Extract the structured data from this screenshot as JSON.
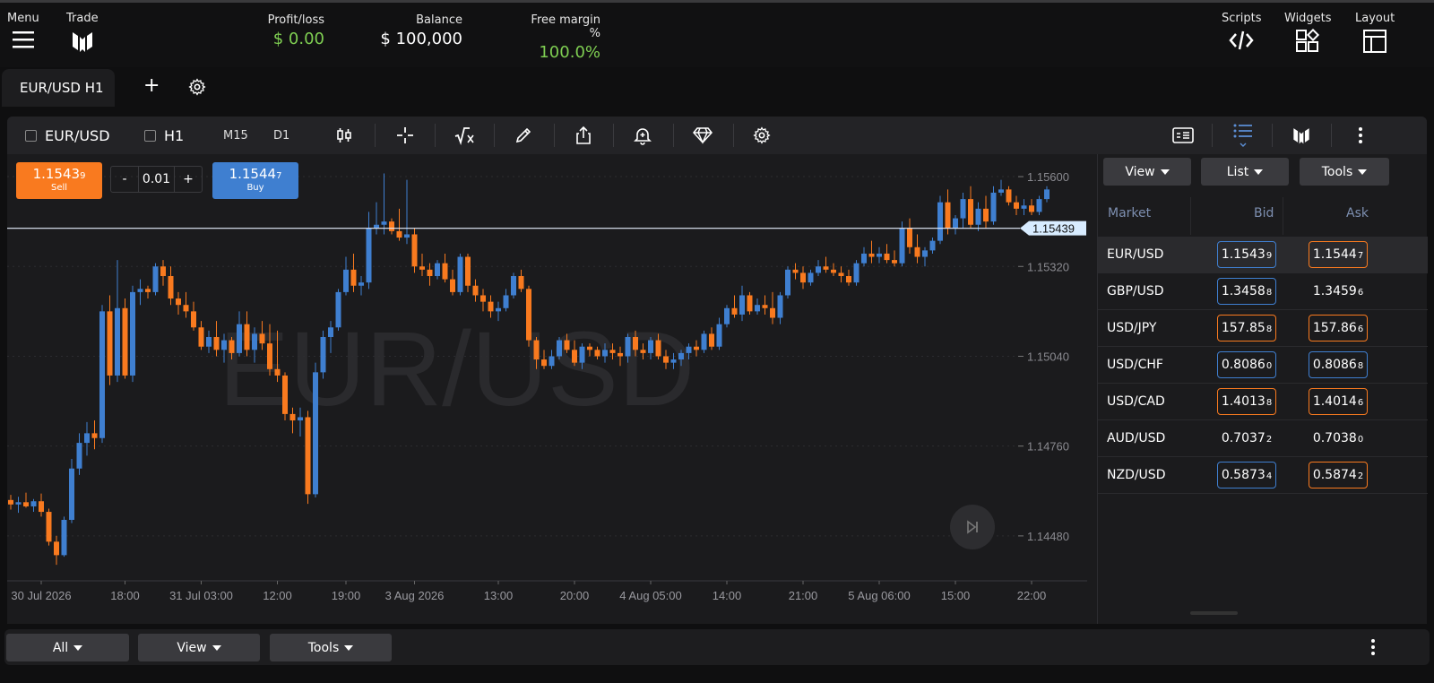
{
  "topbar": {
    "menu_label": "Menu",
    "trade_label": "Trade",
    "profit_loss_label": "Profit/loss",
    "profit_loss_value": "$ 0.00",
    "balance_label": "Balance",
    "balance_value": "$ 100,000",
    "free_margin_label": "Free margin %",
    "free_margin_value": "100.0%",
    "scripts_label": "Scripts",
    "widgets_label": "Widgets",
    "layout_label": "Layout"
  },
  "tabs": {
    "active_label": "EUR/USD H1",
    "add_label": "+"
  },
  "toolbar": {
    "symbol": "EUR/USD",
    "timeframe": "H1",
    "tf_m15": "M15",
    "tf_d1": "D1"
  },
  "order": {
    "sell_price_main": "1.1543",
    "sell_price_pip": "9",
    "sell_label": "Sell",
    "qty_minus": "-",
    "qty_value": "0.01",
    "qty_plus": "+",
    "buy_price_main": "1.1544",
    "buy_price_pip": "7",
    "buy_label": "Buy"
  },
  "colors": {
    "up": "#3f7fd0",
    "down": "#f97a1f",
    "green_value": "#7fcf52"
  },
  "chart_data": {
    "type": "candlestick",
    "watermark": "EUR/USD",
    "current_price_label": "1.15439",
    "current_price": 1.15439,
    "ylim": [
      1.1434,
      1.1567
    ],
    "y_ticks": [
      "1.15600",
      "1.15320",
      "1.15040",
      "1.14760",
      "1.14480"
    ],
    "y_tick_values": [
      1.156,
      1.1532,
      1.1504,
      1.1476,
      1.1448
    ],
    "x_ticks": [
      "30 Jul 2026",
      "18:00",
      "31 Jul 03:00",
      "12:00",
      "19:00",
      "3 Aug 2026",
      "13:00",
      "20:00",
      "4 Aug 05:00",
      "14:00",
      "21:00",
      "5 Aug 06:00",
      "15:00",
      "22:00"
    ],
    "x_tick_index": [
      4,
      15,
      25,
      35,
      44,
      53,
      64,
      74,
      84,
      94,
      104,
      114,
      124,
      134
    ],
    "candles": [
      [
        1.14592,
        1.14608,
        1.14562,
        1.14578
      ],
      [
        1.14578,
        1.14602,
        1.14552,
        1.14585
      ],
      [
        1.14585,
        1.14615,
        1.14568,
        1.14572
      ],
      [
        1.14572,
        1.14595,
        1.14555,
        1.14588
      ],
      [
        1.14588,
        1.14612,
        1.1454,
        1.14555
      ],
      [
        1.14555,
        1.14565,
        1.1445,
        1.14462
      ],
      [
        1.14462,
        1.1448,
        1.1439,
        1.1442
      ],
      [
        1.1442,
        1.1454,
        1.14415,
        1.1453
      ],
      [
        1.1453,
        1.1472,
        1.1452,
        1.1469
      ],
      [
        1.1469,
        1.148,
        1.1467,
        1.1477
      ],
      [
        1.1477,
        1.14835,
        1.1473,
        1.148
      ],
      [
        1.148,
        1.1484,
        1.1475,
        1.14785
      ],
      [
        1.14785,
        1.152,
        1.1477,
        1.1518
      ],
      [
        1.1518,
        1.1523,
        1.1495,
        1.1498
      ],
      [
        1.1498,
        1.1534,
        1.1496,
        1.1519
      ],
      [
        1.1519,
        1.1522,
        1.1497,
        1.1498
      ],
      [
        1.1498,
        1.1526,
        1.1496,
        1.1524
      ],
      [
        1.1524,
        1.1528,
        1.152,
        1.1525
      ],
      [
        1.1525,
        1.1526,
        1.1522,
        1.1524
      ],
      [
        1.1524,
        1.1533,
        1.1523,
        1.1532
      ],
      [
        1.1532,
        1.1534,
        1.1526,
        1.1529
      ],
      [
        1.1529,
        1.1532,
        1.152,
        1.1522
      ],
      [
        1.1522,
        1.1524,
        1.1517,
        1.152
      ],
      [
        1.152,
        1.1524,
        1.1516,
        1.1518
      ],
      [
        1.1518,
        1.1521,
        1.1512,
        1.1513
      ],
      [
        1.1513,
        1.1515,
        1.1506,
        1.1507
      ],
      [
        1.1507,
        1.1512,
        1.1505,
        1.151
      ],
      [
        1.151,
        1.1515,
        1.1504,
        1.1506
      ],
      [
        1.1506,
        1.1511,
        1.1502,
        1.1509
      ],
      [
        1.1509,
        1.151,
        1.1503,
        1.1505
      ],
      [
        1.1505,
        1.1518,
        1.1504,
        1.1514
      ],
      [
        1.1514,
        1.1518,
        1.1504,
        1.1506
      ],
      [
        1.1506,
        1.1513,
        1.1502,
        1.1511
      ],
      [
        1.1511,
        1.1515,
        1.1506,
        1.1508
      ],
      [
        1.1508,
        1.1514,
        1.1498,
        1.15
      ],
      [
        1.15,
        1.1512,
        1.1496,
        1.1498
      ],
      [
        1.1498,
        1.1499,
        1.1484,
        1.1486
      ],
      [
        1.1486,
        1.1488,
        1.148,
        1.1484
      ],
      [
        1.1484,
        1.1488,
        1.1479,
        1.1485
      ],
      [
        1.1485,
        1.1487,
        1.1458,
        1.1461
      ],
      [
        1.1461,
        1.1502,
        1.146,
        1.1499
      ],
      [
        1.1499,
        1.1512,
        1.1497,
        1.151
      ],
      [
        1.151,
        1.1515,
        1.1505,
        1.1513
      ],
      [
        1.1513,
        1.1525,
        1.1512,
        1.1524
      ],
      [
        1.1524,
        1.1535,
        1.1523,
        1.1531
      ],
      [
        1.1531,
        1.1536,
        1.1524,
        1.1526
      ],
      [
        1.1526,
        1.1529,
        1.1523,
        1.1527
      ],
      [
        1.1527,
        1.1549,
        1.1525,
        1.1544
      ],
      [
        1.1544,
        1.1552,
        1.1542,
        1.1545
      ],
      [
        1.1545,
        1.1561,
        1.1542,
        1.1546
      ],
      [
        1.1546,
        1.1547,
        1.1542,
        1.1543
      ],
      [
        1.1543,
        1.155,
        1.154,
        1.1541
      ],
      [
        1.1541,
        1.1559,
        1.1539,
        1.1542
      ],
      [
        1.1542,
        1.1544,
        1.153,
        1.1532
      ],
      [
        1.1532,
        1.1536,
        1.1529,
        1.1531
      ],
      [
        1.1531,
        1.1533,
        1.1526,
        1.1529
      ],
      [
        1.1529,
        1.1534,
        1.1528,
        1.1533
      ],
      [
        1.1533,
        1.1536,
        1.1527,
        1.1528
      ],
      [
        1.1528,
        1.1531,
        1.1523,
        1.1524
      ],
      [
        1.1524,
        1.1536,
        1.1523,
        1.1535
      ],
      [
        1.1535,
        1.1536,
        1.1524,
        1.1526
      ],
      [
        1.1526,
        1.1528,
        1.1521,
        1.1523
      ],
      [
        1.1523,
        1.1525,
        1.1518,
        1.1521
      ],
      [
        1.1521,
        1.1523,
        1.1516,
        1.1518
      ],
      [
        1.1518,
        1.1521,
        1.1515,
        1.1519
      ],
      [
        1.1519,
        1.1525,
        1.1518,
        1.1523
      ],
      [
        1.1523,
        1.153,
        1.1522,
        1.1529
      ],
      [
        1.1529,
        1.1531,
        1.1524,
        1.1525
      ],
      [
        1.1525,
        1.1526,
        1.1507,
        1.1509
      ],
      [
        1.1509,
        1.151,
        1.15,
        1.1503
      ],
      [
        1.1503,
        1.1506,
        1.15,
        1.1501
      ],
      [
        1.1501,
        1.1506,
        1.15,
        1.1504
      ],
      [
        1.1504,
        1.151,
        1.1503,
        1.1509
      ],
      [
        1.1509,
        1.1511,
        1.1505,
        1.1506
      ],
      [
        1.1506,
        1.1509,
        1.1501,
        1.1502
      ],
      [
        1.1502,
        1.1508,
        1.15,
        1.1507
      ],
      [
        1.1507,
        1.1508,
        1.1504,
        1.1506
      ],
      [
        1.1506,
        1.1507,
        1.1503,
        1.1504
      ],
      [
        1.1504,
        1.1508,
        1.1502,
        1.1506
      ],
      [
        1.1506,
        1.1508,
        1.1503,
        1.1505
      ],
      [
        1.1505,
        1.1507,
        1.1501,
        1.1504
      ],
      [
        1.1504,
        1.1511,
        1.1502,
        1.151
      ],
      [
        1.151,
        1.1512,
        1.1504,
        1.1506
      ],
      [
        1.1506,
        1.1508,
        1.1503,
        1.1505
      ],
      [
        1.1505,
        1.151,
        1.1503,
        1.1509
      ],
      [
        1.1509,
        1.1511,
        1.1503,
        1.1504
      ],
      [
        1.1504,
        1.1506,
        1.15,
        1.1502
      ],
      [
        1.1502,
        1.1505,
        1.15,
        1.1503
      ],
      [
        1.1503,
        1.1506,
        1.1501,
        1.1505
      ],
      [
        1.1505,
        1.1508,
        1.1503,
        1.1507
      ],
      [
        1.1507,
        1.1509,
        1.1504,
        1.1506
      ],
      [
        1.1506,
        1.1512,
        1.1505,
        1.1511
      ],
      [
        1.1511,
        1.1513,
        1.1506,
        1.1507
      ],
      [
        1.1507,
        1.1516,
        1.1506,
        1.1514
      ],
      [
        1.1514,
        1.152,
        1.1513,
        1.1519
      ],
      [
        1.1519,
        1.1523,
        1.1516,
        1.1517
      ],
      [
        1.1517,
        1.1526,
        1.1515,
        1.1523
      ],
      [
        1.1523,
        1.1524,
        1.1517,
        1.1518
      ],
      [
        1.1518,
        1.1522,
        1.1517,
        1.152
      ],
      [
        1.152,
        1.1523,
        1.1517,
        1.1519
      ],
      [
        1.1519,
        1.1524,
        1.1514,
        1.1516
      ],
      [
        1.1516,
        1.1524,
        1.1514,
        1.1523
      ],
      [
        1.1523,
        1.1532,
        1.1522,
        1.1531
      ],
      [
        1.1531,
        1.1533,
        1.1528,
        1.153
      ],
      [
        1.153,
        1.1532,
        1.1525,
        1.1527
      ],
      [
        1.1527,
        1.1531,
        1.1526,
        1.153
      ],
      [
        1.153,
        1.1534,
        1.1529,
        1.1532
      ],
      [
        1.1532,
        1.1535,
        1.153,
        1.1531
      ],
      [
        1.1531,
        1.1533,
        1.1529,
        1.153
      ],
      [
        1.153,
        1.1532,
        1.1527,
        1.1529
      ],
      [
        1.1529,
        1.1531,
        1.1526,
        1.1527
      ],
      [
        1.1527,
        1.1534,
        1.1526,
        1.1533
      ],
      [
        1.1533,
        1.1538,
        1.1532,
        1.1536
      ],
      [
        1.1536,
        1.154,
        1.1533,
        1.1535
      ],
      [
        1.1535,
        1.1538,
        1.1533,
        1.1536
      ],
      [
        1.1536,
        1.1539,
        1.1533,
        1.1534
      ],
      [
        1.1534,
        1.1537,
        1.1532,
        1.1533
      ],
      [
        1.1533,
        1.1546,
        1.1532,
        1.1544
      ],
      [
        1.1544,
        1.1547,
        1.1536,
        1.1538
      ],
      [
        1.1538,
        1.1542,
        1.1533,
        1.1535
      ],
      [
        1.1535,
        1.1538,
        1.1532,
        1.1537
      ],
      [
        1.1537,
        1.1541,
        1.1536,
        1.154
      ],
      [
        1.154,
        1.1554,
        1.1539,
        1.1552
      ],
      [
        1.1552,
        1.1556,
        1.1542,
        1.1544
      ],
      [
        1.1544,
        1.1548,
        1.1542,
        1.1547
      ],
      [
        1.1547,
        1.1555,
        1.1544,
        1.1553
      ],
      [
        1.1553,
        1.1557,
        1.1544,
        1.1545
      ],
      [
        1.1545,
        1.1552,
        1.1543,
        1.155
      ],
      [
        1.155,
        1.1554,
        1.1544,
        1.1546
      ],
      [
        1.1546,
        1.1557,
        1.1545,
        1.1555
      ],
      [
        1.1555,
        1.1559,
        1.1554,
        1.1556
      ],
      [
        1.1556,
        1.1557,
        1.1551,
        1.1552
      ],
      [
        1.1552,
        1.1554,
        1.1548,
        1.155
      ],
      [
        1.155,
        1.1553,
        1.1548,
        1.1551
      ],
      [
        1.1551,
        1.1553,
        1.1548,
        1.1549
      ],
      [
        1.1549,
        1.1554,
        1.1548,
        1.1553
      ],
      [
        1.1553,
        1.1557,
        1.1552,
        1.1556
      ]
    ]
  },
  "panel": {
    "view_label": "View",
    "list_label": "List",
    "tools_label": "Tools",
    "col_market": "Market",
    "col_bid": "Bid",
    "col_ask": "Ask",
    "rows": [
      {
        "market": "EUR/USD",
        "bid_main": "1.1543",
        "bid_pip": "9",
        "ask_main": "1.1544",
        "ask_pip": "7"
      },
      {
        "market": "GBP/USD",
        "bid_main": "1.3458",
        "bid_pip": "8",
        "ask_main": "1.3459",
        "ask_pip": "6"
      },
      {
        "market": "USD/JPY",
        "bid_main": "157.85",
        "bid_pip": "8",
        "ask_main": "157.86",
        "ask_pip": "6"
      },
      {
        "market": "USD/CHF",
        "bid_main": "0.8086",
        "bid_pip": "0",
        "ask_main": "0.8086",
        "ask_pip": "8"
      },
      {
        "market": "USD/CAD",
        "bid_main": "1.4013",
        "bid_pip": "8",
        "ask_main": "1.4014",
        "ask_pip": "6"
      },
      {
        "market": "AUD/USD",
        "bid_main": "0.7037",
        "bid_pip": "2",
        "ask_main": "0.7038",
        "ask_pip": "0"
      },
      {
        "market": "NZD/USD",
        "bid_main": "0.5873",
        "bid_pip": "4",
        "ask_main": "0.5874",
        "ask_pip": "2"
      }
    ]
  },
  "bottombar": {
    "all_label": "All",
    "view_label": "View",
    "tools_label": "Tools"
  }
}
